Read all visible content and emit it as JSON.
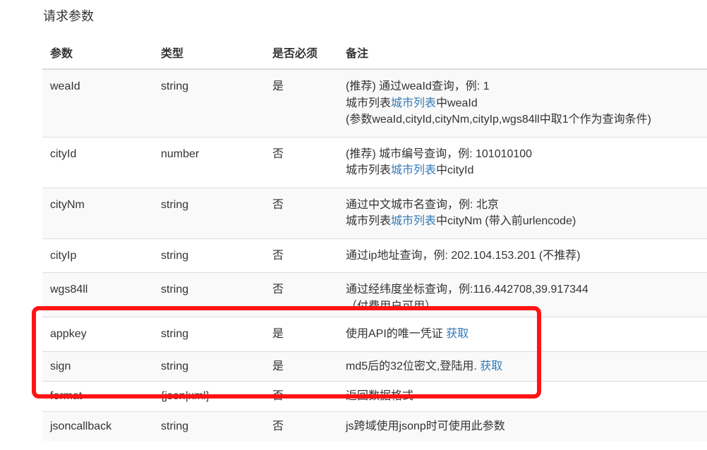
{
  "section_title": "请求参数",
  "headers": {
    "param": "参数",
    "type": "类型",
    "required": "是否必须",
    "notes": "备注"
  },
  "rows": [
    {
      "param": "weaId",
      "type": "string",
      "required": "是",
      "notes": [
        {
          "text": "(推荐) 通过weaId查询，例: 1"
        },
        {
          "pre": "城市列表",
          "link": "城市列表",
          "post": "中weaId"
        },
        {
          "text": "(参数weaId,cityId,cityNm,cityIp,wgs84ll中取1个作为查询条件)"
        }
      ]
    },
    {
      "param": "cityId",
      "type": "number",
      "required": "否",
      "notes": [
        {
          "text": "(推荐) 城市编号查询，例: 101010100"
        },
        {
          "pre": "城市列表",
          "link": "城市列表",
          "post": "中cityId"
        }
      ]
    },
    {
      "param": "cityNm",
      "type": "string",
      "required": "否",
      "notes": [
        {
          "text": "通过中文城市名查询，例: 北京"
        },
        {
          "pre": "城市列表",
          "link": "城市列表",
          "post": "中cityNm (带入前urlencode)"
        }
      ]
    },
    {
      "param": "cityIp",
      "type": "string",
      "required": "否",
      "notes": [
        {
          "text": "通过ip地址查询，例: 202.104.153.201 (不推荐)"
        }
      ]
    },
    {
      "param": "wgs84ll",
      "type": "string",
      "required": "否",
      "notes": [
        {
          "text": "通过经纬度坐标查询，例:116.442708,39.917344"
        },
        {
          "text": "（付费用户可用）"
        }
      ]
    },
    {
      "param": "appkey",
      "type": "string",
      "required": "是",
      "notes_text": "使用API的唯一凭证 ",
      "notes_link": "获取"
    },
    {
      "param": "sign",
      "type": "string",
      "required": "是",
      "notes_text": "md5后的32位密文,登陆用. ",
      "notes_link": "获取"
    },
    {
      "param": "format",
      "type": "{json|xml}",
      "required": "否",
      "notes_text": "返回数据格式"
    },
    {
      "param": "jsoncallback",
      "type": "string",
      "required": "否",
      "notes_text": "js跨域使用jsonp时可使用此参数"
    }
  ],
  "annotation": {
    "color": "#ff1414"
  },
  "colors": {
    "link": "#337ab7",
    "stripe": "#f9f9f9",
    "border": "#dddddd"
  }
}
